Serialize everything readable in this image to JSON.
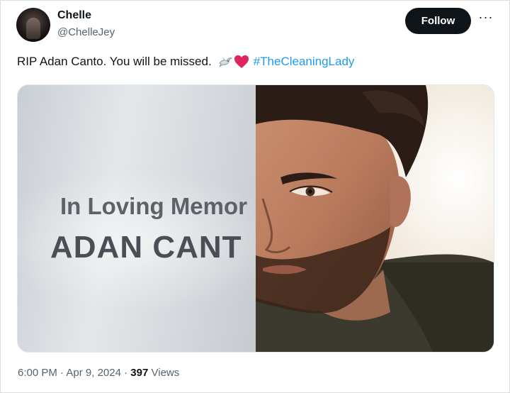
{
  "author": {
    "display_name": "Chelle",
    "handle": "@ChelleJey",
    "avatar_icon": "profile-photo"
  },
  "actions": {
    "follow_label": "Follow",
    "more_icon": "more-options-icon",
    "more_glyph": "···"
  },
  "tweet": {
    "text": "RIP Adan Canto. You will be missed.",
    "emojis": [
      "dove-icon",
      "red-heart-icon"
    ],
    "hashtag": "#TheCleaningLady"
  },
  "media": {
    "left_panel": {
      "line1": "In Loving Memor",
      "line2": "ADAN CANT"
    },
    "right_panel": {
      "description_icon": "portrait-photo"
    }
  },
  "meta": {
    "time": "6:00 PM",
    "separator": "·",
    "date": "Apr 9, 2024",
    "views_count": "397",
    "views_label": "Views"
  },
  "colors": {
    "link": "#1d9bf0",
    "button_bg": "#0f1419",
    "secondary_text": "#536471",
    "heart": "#e0245e"
  }
}
